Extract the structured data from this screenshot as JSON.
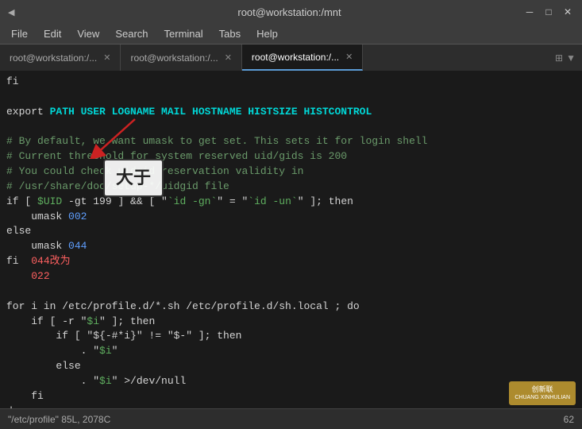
{
  "titleBar": {
    "title": "root@workstation:/mnt",
    "minimizeIcon": "─",
    "maximizeIcon": "□",
    "closeIcon": "✕"
  },
  "menuBar": {
    "items": [
      "File",
      "Edit",
      "View",
      "Search",
      "Terminal",
      "Tabs",
      "Help"
    ]
  },
  "tabs": [
    {
      "label": "root@workstation:/...",
      "active": false
    },
    {
      "label": "root@workstation:/...",
      "active": false
    },
    {
      "label": "root@workstation:/...",
      "active": true
    }
  ],
  "terminal": {
    "lines": [
      {
        "text": "fi",
        "color": "default"
      },
      {
        "text": "",
        "color": "default"
      },
      {
        "text": "export PATH USER LOGNAME MAIL HOSTNAME HISTSIZE HISTCONTROL",
        "color": "cyan_export"
      },
      {
        "text": "",
        "color": "default"
      },
      {
        "text": "# By default, we want umask to get set. This sets it for login shell",
        "color": "comment"
      },
      {
        "text": "# Current threshold for system reserved uid/gids is 200",
        "color": "comment"
      },
      {
        "text": "# You could check uidgid reservation validity in",
        "color": "comment"
      },
      {
        "text": "# /usr/share/doc/setup-*/uidgid file",
        "color": "comment"
      },
      {
        "text": "if [ $UID -gt 199 ] && [ \"`id -gn`\" = \"`id -un`\" ]; then",
        "color": "code"
      },
      {
        "text": "    umask 002",
        "color": "code_blue"
      },
      {
        "text": "else",
        "color": "code"
      },
      {
        "text": "    umask 044",
        "color": "code_blue"
      },
      {
        "text": "fi   044改为",
        "color": "annotation_line"
      },
      {
        "text": "     022",
        "color": "annotation_line2"
      },
      {
        "text": "",
        "color": "default"
      },
      {
        "text": "for i in /etc/profile.d/*.sh /etc/profile.d/sh.local ; do",
        "color": "code"
      },
      {
        "text": "    if [ -r \"$i\" ]; then",
        "color": "code"
      },
      {
        "text": "        if [ \"${-#*i}\" != \"$-\" ]; then",
        "color": "code"
      },
      {
        "text": "            . \"$i\"",
        "color": "code"
      },
      {
        "text": "        else",
        "color": "code"
      },
      {
        "text": "            . \"$i\" >/dev/null",
        "color": "code"
      },
      {
        "text": "    fi",
        "color": "code"
      },
      {
        "text": "done",
        "color": "code"
      }
    ]
  },
  "statusBar": {
    "fileInfo": "\"/etc/profile\" 85L, 2078C",
    "lineInfo": "62"
  },
  "annotation": {
    "text": "大于",
    "arrowText": "↘"
  },
  "watermark": {
    "line1": "创新联",
    "line2": "CHUANG XINHULIAN"
  }
}
